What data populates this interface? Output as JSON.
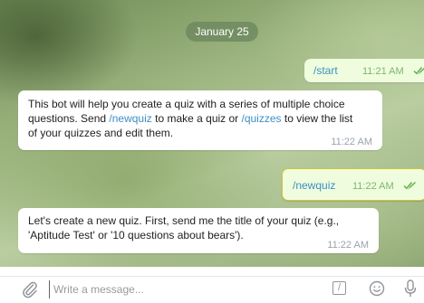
{
  "chat": {
    "date": "January 25",
    "messages": [
      {
        "from": "me",
        "text": "/start",
        "time": "11:21 AM"
      },
      {
        "from": "bot",
        "line1_a": "This bot will help you create a quiz with a series of multiple choice",
        "line2_a": "questions. Send ",
        "line2_cmd1": "/newquiz",
        "line2_b": " to make a quiz or ",
        "line2_cmd2": "/quizzes",
        "line2_c": " to view the list",
        "line3": "of your quizzes and edit them.",
        "time": "11:22 AM"
      },
      {
        "from": "me",
        "text": "/newquiz",
        "time": "11:22 AM"
      },
      {
        "from": "bot",
        "line1": "Let's create a new quiz. First, send me the title of your quiz (e.g.,",
        "line2": "'Aptitude Test' or '10 questions about bears').",
        "time": "11:22 AM"
      }
    ]
  },
  "composer": {
    "placeholder": "Write a message...",
    "command_glyph": "/"
  },
  "icons": {
    "attach": "paperclip-icon",
    "command": "slash-command-icon",
    "emoji": "smiley-icon",
    "mic": "microphone-icon",
    "read": "double-check-icon"
  },
  "colors": {
    "outgoing_bubble": "#effdde",
    "incoming_bubble": "#ffffff",
    "command_link": "#3c8fc4",
    "read_check": "#5fb24e",
    "highlight_border": "#d6c13a",
    "date_pill": "#708a60"
  }
}
